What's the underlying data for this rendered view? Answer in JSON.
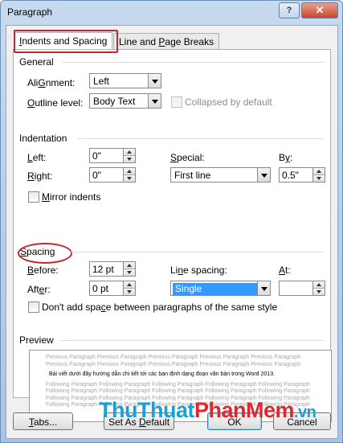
{
  "window": {
    "title": "Paragraph",
    "help_label": "?",
    "close_label": "✕"
  },
  "tabs": [
    {
      "label_pre": "",
      "label_key": "I",
      "label_post": "ndents and Spacing"
    },
    {
      "label_pre": "Line and ",
      "label_key": "P",
      "label_post": "age Breaks"
    }
  ],
  "general": {
    "title": "General",
    "alignment_label_key": "G",
    "alignment_label_post": "nment:",
    "alignment_label_pre": "Ali",
    "alignment_value": "Left",
    "outline_label_key": "O",
    "outline_label_post": "utline level:",
    "outline_value": "Body Text",
    "collapsed_label": "Collapsed by default"
  },
  "indentation": {
    "title": "Indentation",
    "left_label_key": "L",
    "left_label_post": "eft:",
    "left_value": "0\"",
    "right_label_key": "R",
    "right_label_post": "ight:",
    "right_value": "0\"",
    "special_label_pre": "",
    "special_label_key": "S",
    "special_label_post": "pecial:",
    "special_value": "First line",
    "by_label_pre": "B",
    "by_label_key": "y",
    "by_label_post": ":",
    "by_value": "0.5\"",
    "mirror_label_key": "M",
    "mirror_label_post": "irror indents"
  },
  "spacing": {
    "title": "Spacing",
    "title_key": "S",
    "title_post": "pacing",
    "before_label_key": "B",
    "before_label_post": "efore:",
    "before_value": "12 pt",
    "after_label_pre": "Aft",
    "after_label_key": "e",
    "after_label_post": "r:",
    "after_value": "0 pt",
    "line_label_pre": "Li",
    "line_label_key": "n",
    "line_label_post": "e spacing:",
    "line_value": "Single",
    "at_label_key": "A",
    "at_label_post": "t:",
    "at_value": "",
    "dont_add_pre": "Don't add spa",
    "dont_add_key": "c",
    "dont_add_post": "e between paragraphs of the same style"
  },
  "preview": {
    "title": "Preview",
    "previous_text": "Previous Paragraph Previous Paragraph Previous Paragraph Previous Paragraph Previous Paragraph Previous Paragraph Previous Paragraph Previous Paragraph Previous Paragraph Previous Paragraph",
    "main_text": "Bài viết dưới đây hướng dẫn chi tiết tới các bạn định dạng đoạn văn bản trong Word 2013.",
    "following_text": "Following Paragraph Following Paragraph Following Paragraph Following Paragraph Following Paragraph Following Paragraph Following Paragraph Following Paragraph Following Paragraph Following Paragraph Following Paragraph Following Paragraph Following Paragraph Following Paragraph Following Paragraph Following Paragraph Following Paragraph Following Paragraph Following Paragraph Following Paragraph"
  },
  "buttons": {
    "tabs_key": "T",
    "tabs_post": "abs...",
    "default_pre": "Set As ",
    "default_key": "D",
    "default_post": "efault",
    "ok": "OK",
    "cancel": "Cancel"
  },
  "watermark": {
    "part_a": "ThuThuat",
    "part_b": "PhanMem",
    "part_c": ".vn"
  },
  "colors": {
    "highlight_ring": "#c0282f",
    "selection": "#3399ff",
    "watermark_blue": "#1aa0d8",
    "watermark_red": "#e0262e"
  }
}
